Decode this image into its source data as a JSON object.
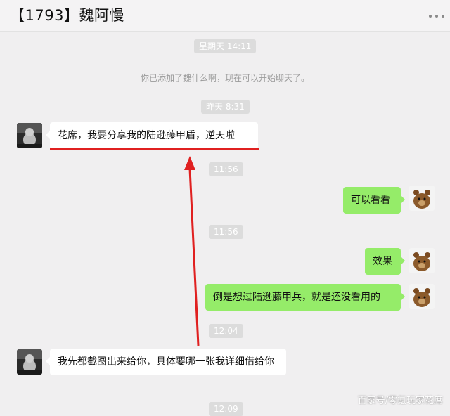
{
  "header": {
    "title": "【1793】魏阿慢",
    "more_icon": "more-icon"
  },
  "timestamps": {
    "t1": "星期天 14:11",
    "t2": "昨天 8:31",
    "t3": "11:56",
    "t4": "11:56",
    "t5": "12:04",
    "t6": "12:09"
  },
  "system_message": "你已添加了魏什么啊，现在可以开始聊天了。",
  "messages": [
    {
      "side": "left",
      "text": "花席，我要分享我的陆逊藤甲盾，逆天啦"
    },
    {
      "side": "right",
      "text": "可以看看"
    },
    {
      "side": "right",
      "text": "效果"
    },
    {
      "side": "right",
      "text": "倒是想过陆逊藤甲兵，就是还没看用的"
    },
    {
      "side": "left",
      "text": "我先都截图出来给你，具体要哪一张我详细借给你"
    }
  ],
  "watermark": "百家号/零氪玩家花席",
  "colors": {
    "accent_annotation": "#e02020",
    "bubble_self": "#95ec69",
    "bubble_other": "#ffffff",
    "background": "#f0eff0"
  }
}
